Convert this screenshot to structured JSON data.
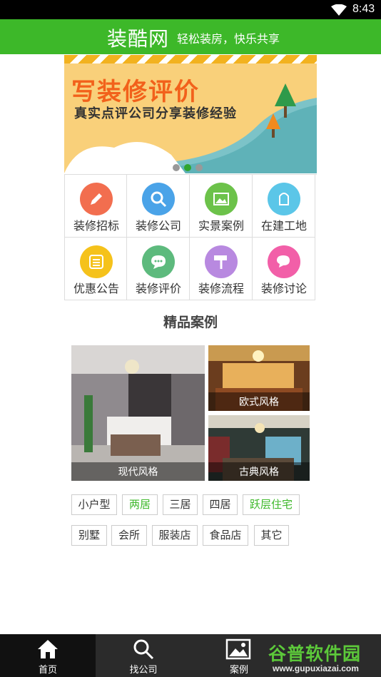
{
  "status_bar": {
    "time": "8:43"
  },
  "app_bar": {
    "logo": "装酷网",
    "slogan": "轻松装房，快乐共享"
  },
  "banner": {
    "title": "写装修评价",
    "subtitle": "真实点评公司分享装修经验",
    "active_dot": 1,
    "dot_count": 3
  },
  "categories": [
    {
      "label": "装修招标",
      "icon": "pencil-icon",
      "color": "#f26e4f"
    },
    {
      "label": "装修公司",
      "icon": "search-icon",
      "color": "#4aa3e8"
    },
    {
      "label": "实景案例",
      "icon": "image-icon",
      "color": "#6cc24a"
    },
    {
      "label": "在建工地",
      "icon": "building-icon",
      "color": "#5bc6e8"
    },
    {
      "label": "优惠公告",
      "icon": "notice-icon",
      "color": "#f5c21b"
    },
    {
      "label": "装修评价",
      "icon": "chat-icon",
      "color": "#5dba7d"
    },
    {
      "label": "装修流程",
      "icon": "paint-roller-icon",
      "color": "#b889e0"
    },
    {
      "label": "装修讨论",
      "icon": "discuss-icon",
      "color": "#f25fa8"
    }
  ],
  "section_title": "精品案例",
  "cases": [
    {
      "caption": "现代风格"
    },
    {
      "caption": "欧式风格"
    },
    {
      "caption": "古典风格"
    }
  ],
  "tags": [
    {
      "label": "小户型",
      "highlight": false
    },
    {
      "label": "两居",
      "highlight": true
    },
    {
      "label": "三居",
      "highlight": false
    },
    {
      "label": "四居",
      "highlight": false
    },
    {
      "label": "跃层住宅",
      "highlight": true
    },
    {
      "label": "别墅",
      "highlight": false
    },
    {
      "label": "会所",
      "highlight": false
    },
    {
      "label": "服装店",
      "highlight": false
    },
    {
      "label": "食品店",
      "highlight": false
    },
    {
      "label": "其它",
      "highlight": false
    }
  ],
  "tabs": [
    {
      "label": "首页",
      "icon": "home-icon",
      "active": true
    },
    {
      "label": "找公司",
      "icon": "search-icon",
      "active": false
    },
    {
      "label": "案例",
      "icon": "image-icon",
      "active": false
    }
  ],
  "watermark": {
    "brand": "谷普软件园",
    "url": "www.gupuxiazai.com"
  },
  "colors": {
    "primary_green": "#3db829",
    "tabbar": "#2b2b2b"
  }
}
